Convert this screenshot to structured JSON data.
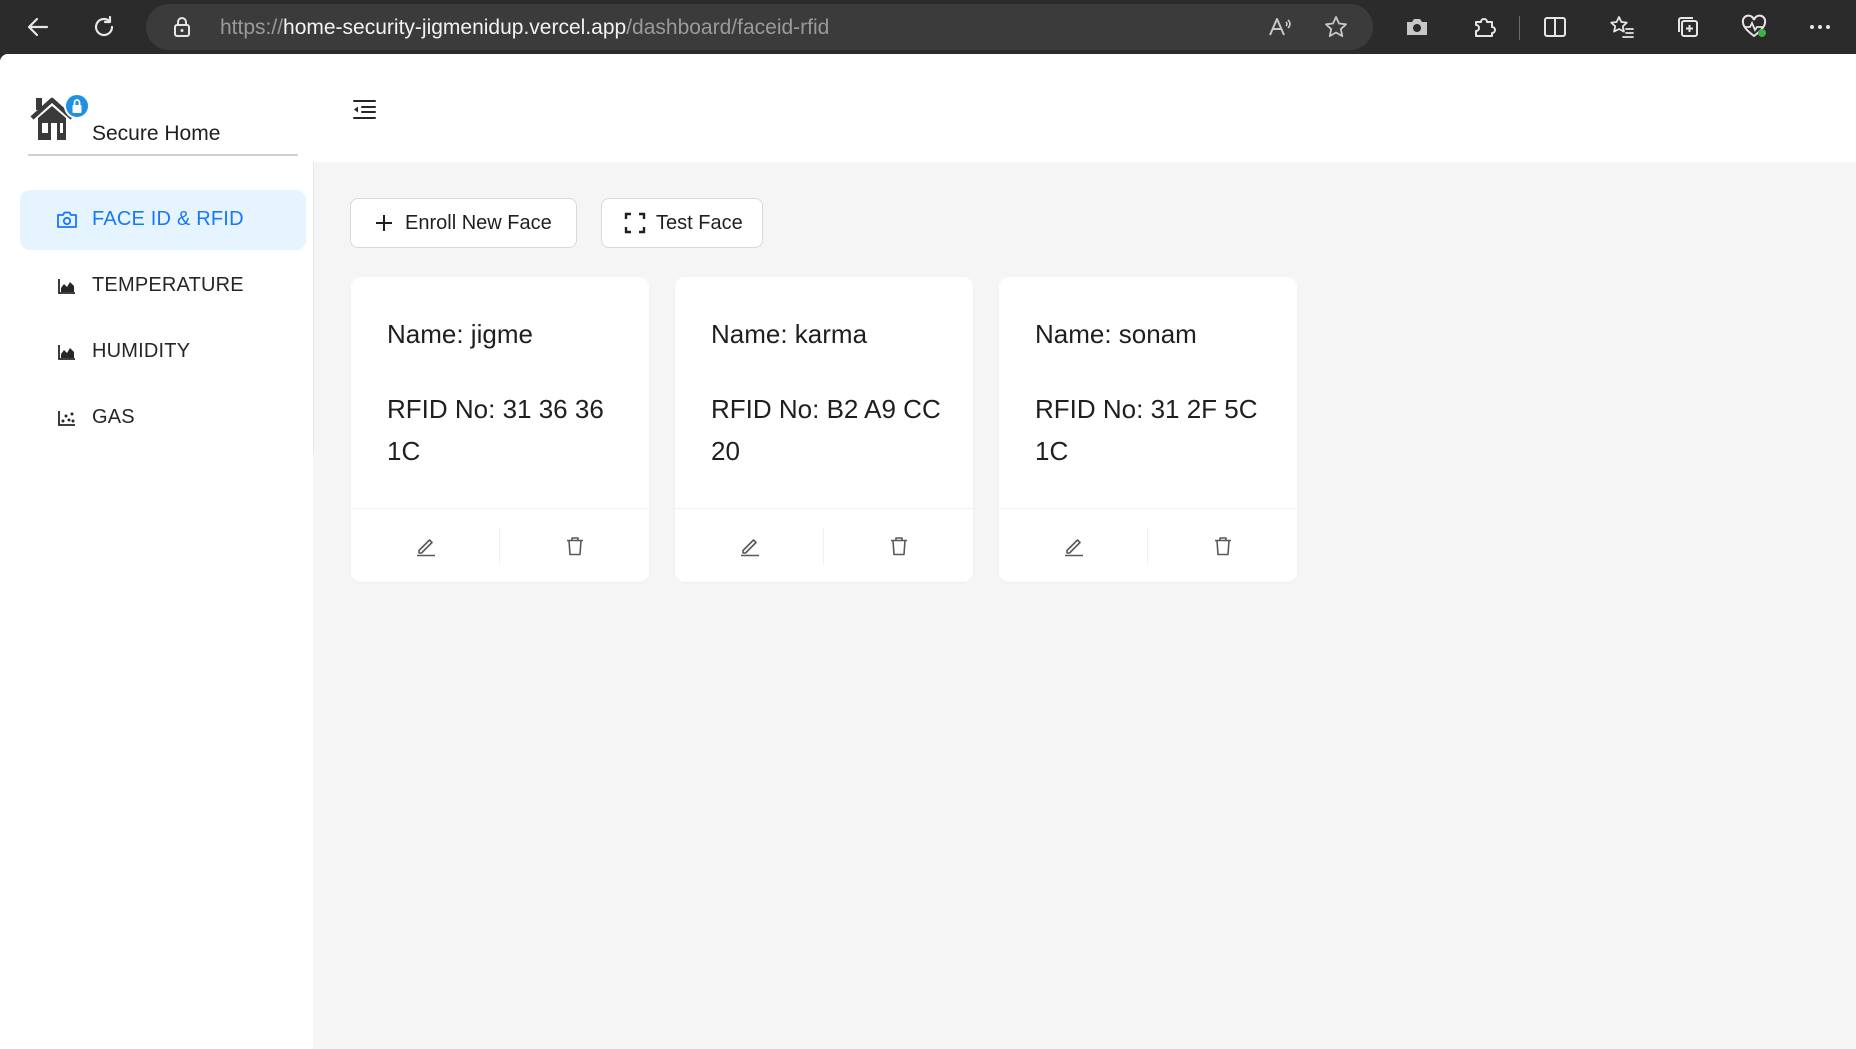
{
  "browser": {
    "url_scheme": "https://",
    "url_host": "home-security-jigmenidup.vercel.app",
    "url_path": "/dashboard/faceid-rfid"
  },
  "app": {
    "title": "Secure Home",
    "accent_color": "#1677ff"
  },
  "sidebar": {
    "items": [
      {
        "label": "FACE ID & RFID",
        "icon": "camera-icon",
        "active": true
      },
      {
        "label": "TEMPERATURE",
        "icon": "area-chart-icon",
        "active": false
      },
      {
        "label": "HUMIDITY",
        "icon": "area-chart-icon",
        "active": false
      },
      {
        "label": "GAS",
        "icon": "dot-chart-icon",
        "active": false
      }
    ]
  },
  "toolbar": {
    "enroll_label": "Enroll New Face",
    "test_label": "Test Face"
  },
  "cards": [
    {
      "name": "Name: jigme",
      "rfid": "RFID No: 31 36 36 1C"
    },
    {
      "name": "Name: karma",
      "rfid": "RFID No: B2 A9 CC 20"
    },
    {
      "name": "Name: sonam",
      "rfid": "RFID No: 31 2F 5C 1C"
    }
  ]
}
